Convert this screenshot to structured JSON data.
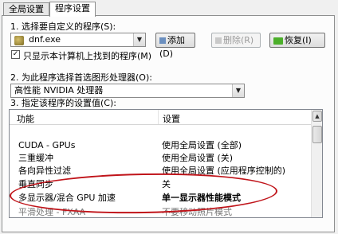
{
  "tabs": [
    {
      "label": "全局设置",
      "active": false
    },
    {
      "label": "程序设置",
      "active": true
    }
  ],
  "step1": {
    "label": "1. 选择要自定义的程序(S):",
    "program_value": "dnf.exe",
    "add_button": "添加(D)",
    "delete_button": "删除(R)",
    "restore_button": "恢复(I)",
    "checkbox_label": "只显示本计算机上找到的程序(M)",
    "checkbox_checked": true
  },
  "step2": {
    "label": "2. 为此程序选择首选图形处理器(O):",
    "gpu_value": "高性能 NVIDIA 处理器"
  },
  "step3": {
    "label": "3. 指定该程序的设置值(C):",
    "col_feature": "功能",
    "col_setting": "设置",
    "rows": [
      {
        "feature": "CUDA - GPUs",
        "setting": "使用全局设置 (全部)"
      },
      {
        "feature": "三重缓冲",
        "setting": "使用全局设置 (关)"
      },
      {
        "feature": "各向异性过滤",
        "setting": "使用全局设置 (应用程序控制的)"
      },
      {
        "feature": "垂直同步",
        "setting": "关"
      },
      {
        "feature": "多显示器/混合 GPU 加速",
        "setting": "单一显示器性能模式"
      },
      {
        "feature": "平滑处理 - FXAA",
        "setting": "不要移动照片模式"
      }
    ]
  },
  "colors": {
    "annotation": "#c0141a",
    "restore_icon": "#4caf2a"
  }
}
